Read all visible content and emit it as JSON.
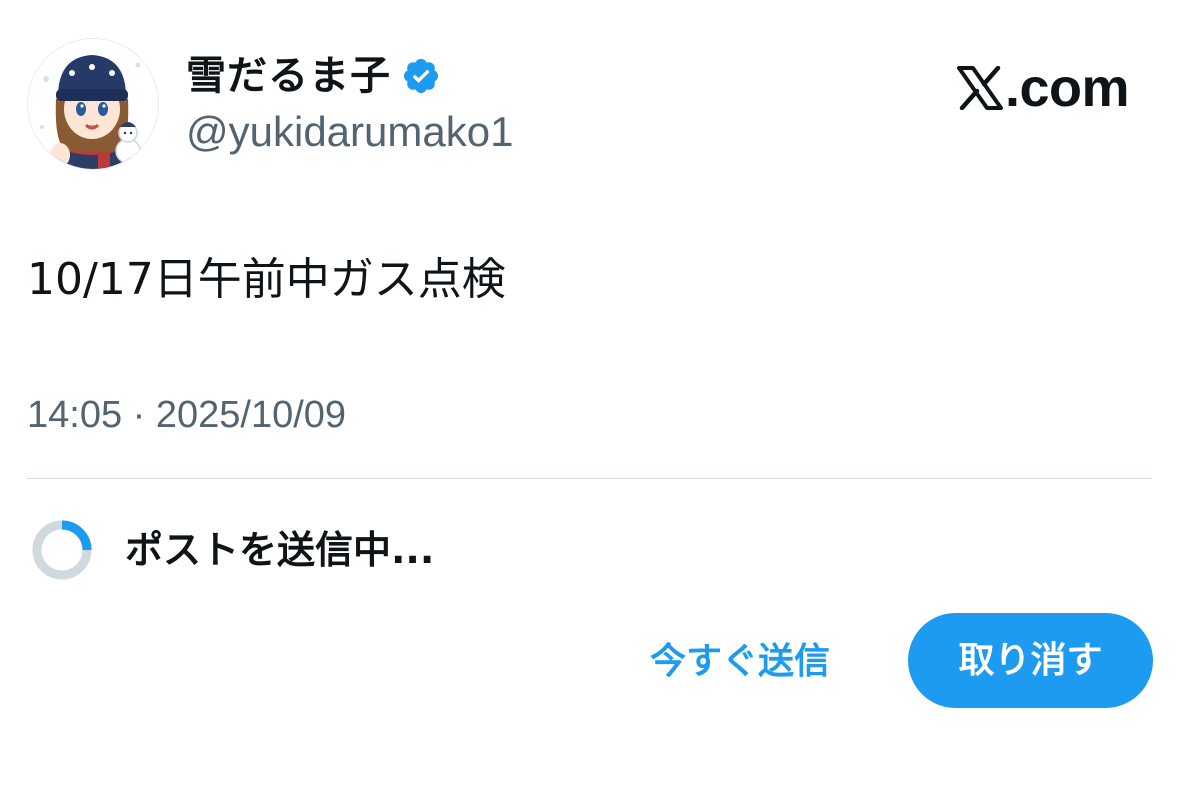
{
  "author": {
    "display_name": "雪だるま子",
    "handle": "@yukidarumako1",
    "verified": true,
    "avatar_icon": "snow-girl-avatar"
  },
  "brand": {
    "logo_icon": "x-logo-icon",
    "text": ".com"
  },
  "post": {
    "text": "10/17日午前中ガス点検",
    "time": "14:05",
    "separator": "·",
    "date": "2025/10/09"
  },
  "sending": {
    "label": "ポストを送信中...",
    "progress": 0.25
  },
  "actions": {
    "send_now_label": "今すぐ送信",
    "undo_label": "取り消す"
  },
  "colors": {
    "accent": "#1d9bf0",
    "text_primary": "#0f1419",
    "text_secondary": "#536471",
    "divider": "#cfd9de"
  }
}
